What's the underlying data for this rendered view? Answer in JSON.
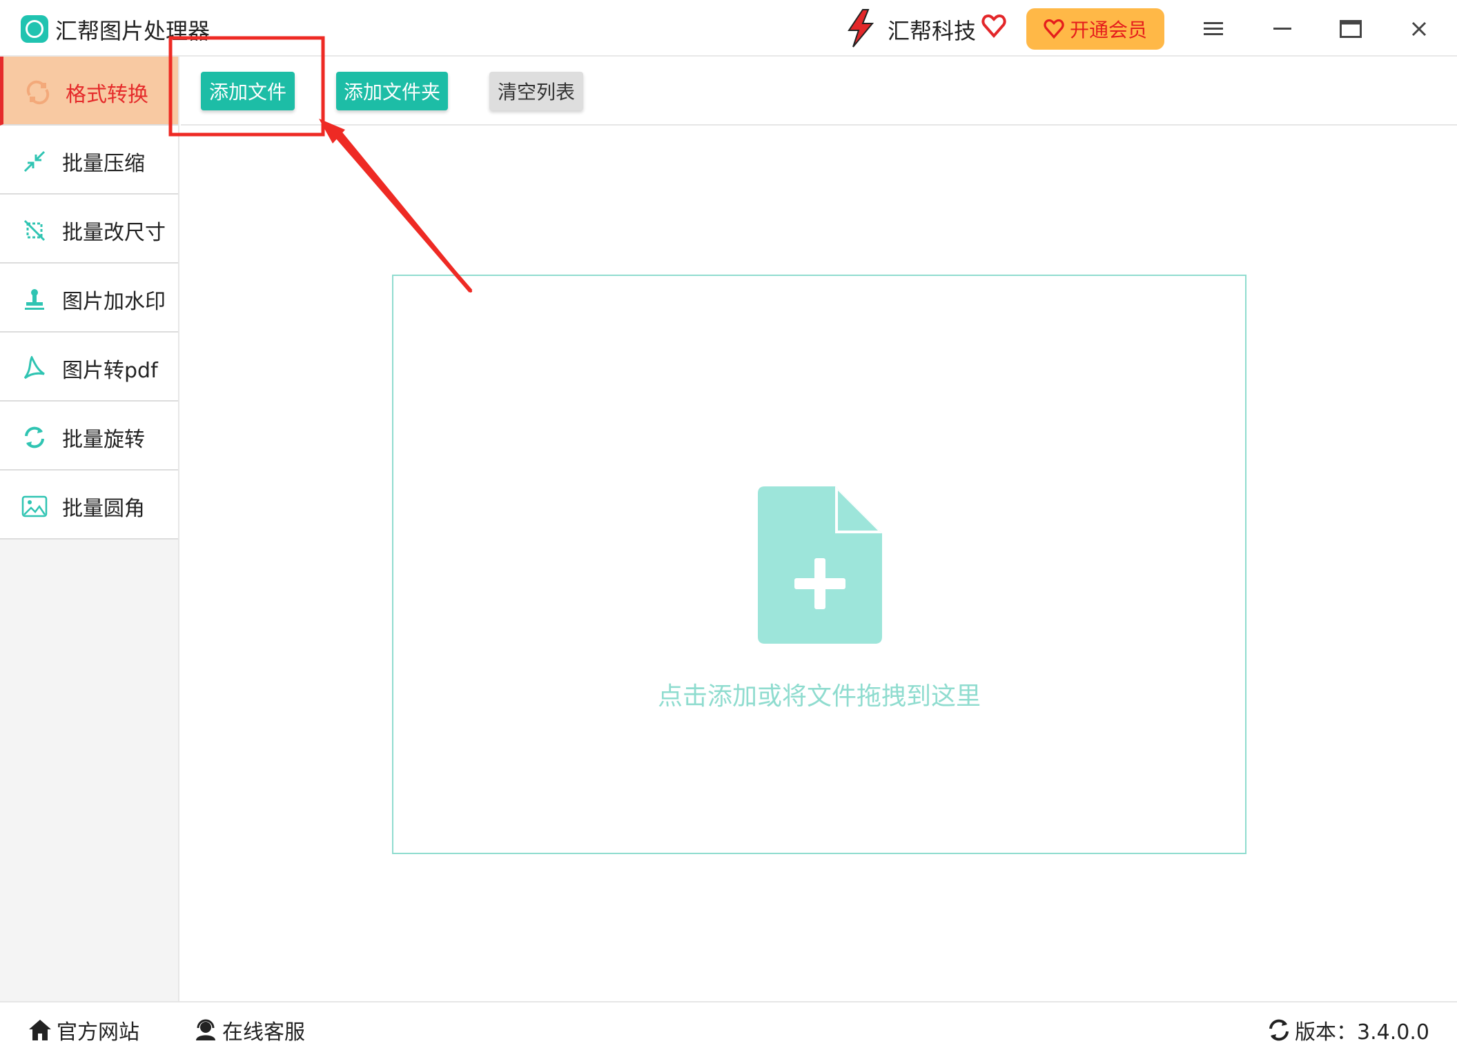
{
  "titlebar": {
    "app_title": "汇帮图片处理器",
    "brand_name": "汇帮科技",
    "vip_label": "开通会员",
    "menu_icon": "hamburger-menu-icon",
    "minimize_icon": "minimize-icon",
    "maximize_icon": "maximize-icon",
    "close_icon": "close-icon"
  },
  "sidebar": {
    "items": [
      {
        "label": "格式转换",
        "icon": "format-convert-icon",
        "active": true
      },
      {
        "label": "批量压缩",
        "icon": "compress-icon",
        "active": false
      },
      {
        "label": "批量改尺寸",
        "icon": "resize-icon",
        "active": false
      },
      {
        "label": "图片加水印",
        "icon": "watermark-stamp-icon",
        "active": false
      },
      {
        "label": "图片转pdf",
        "icon": "pdf-icon",
        "active": false
      },
      {
        "label": "批量旋转",
        "icon": "rotate-icon",
        "active": false
      },
      {
        "label": "批量圆角",
        "icon": "rounded-image-icon",
        "active": false
      }
    ]
  },
  "toolbar": {
    "add_file": "添加文件",
    "add_folder": "添加文件夹",
    "clear_list": "清空列表"
  },
  "dropzone": {
    "hint": "点击添加或将文件拖拽到这里",
    "icon": "add-file-icon"
  },
  "statusbar": {
    "official_site": "官方网站",
    "online_service": "在线客服",
    "version": "版本：3.4.0.0"
  },
  "colors": {
    "accent": "#1dbda6",
    "active_bg": "#f8c9a2",
    "active_text": "#e52b2b",
    "vip": "#ffb847",
    "drop_border": "#8fdccf",
    "annotation": "#ee2a24"
  }
}
